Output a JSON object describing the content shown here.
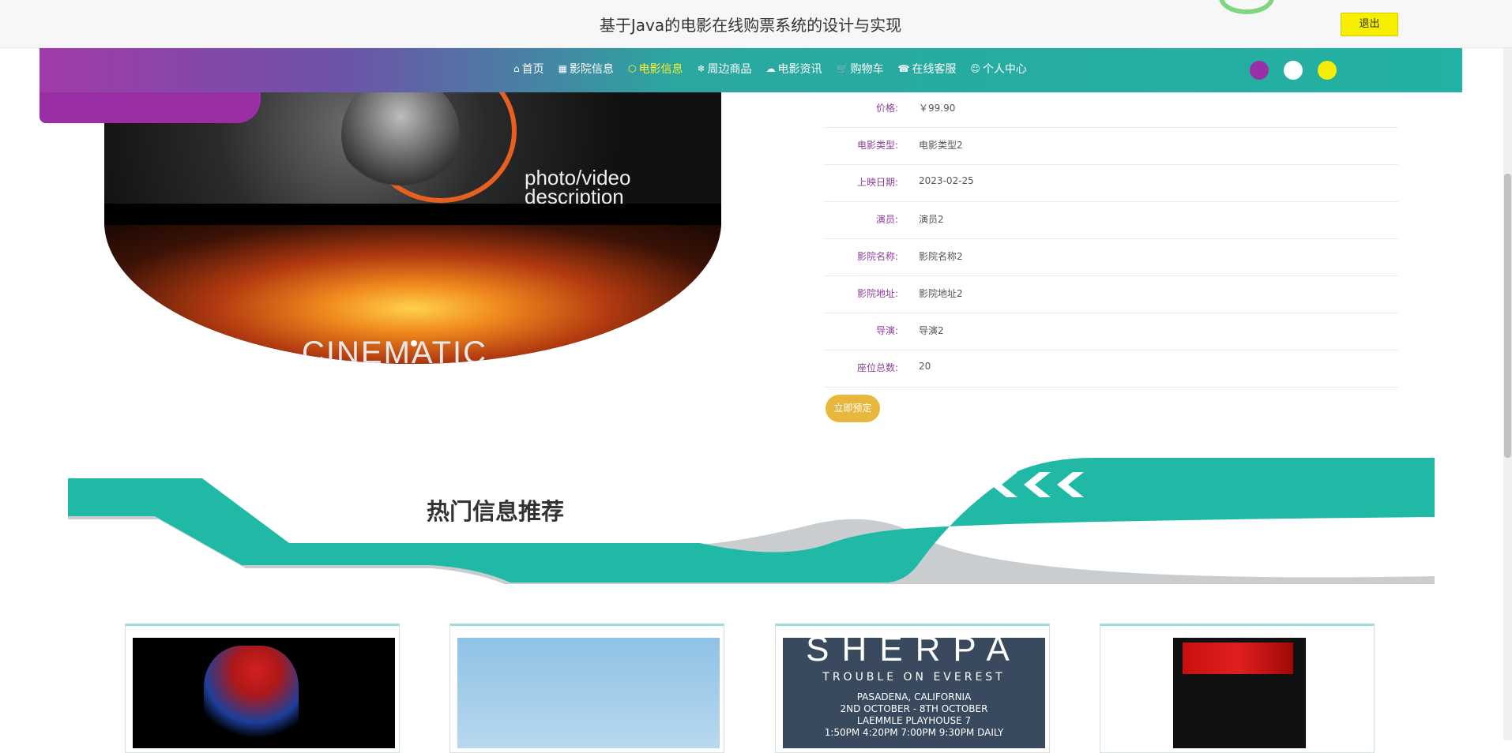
{
  "header": {
    "site_title": "基于Java的电影在线购票系统的设计与实现",
    "logout_label": "退出"
  },
  "nav": {
    "items": [
      {
        "icon": "home-icon",
        "glyph": "⌂",
        "label": "首页"
      },
      {
        "icon": "grid-icon",
        "glyph": "▦",
        "label": "影院信息"
      },
      {
        "icon": "box-icon",
        "glyph": "⬡",
        "label": "电影信息",
        "active": true
      },
      {
        "icon": "snowflake-icon",
        "glyph": "❄",
        "label": "周边商品"
      },
      {
        "icon": "chat-icon",
        "glyph": "☁",
        "label": "电影资讯"
      },
      {
        "icon": "cart-icon",
        "glyph": "🛒",
        "label": "购物车"
      },
      {
        "icon": "support-icon",
        "glyph": "☎",
        "label": "在线客服"
      },
      {
        "icon": "user-icon",
        "glyph": "☺",
        "label": "个人中心"
      }
    ],
    "theme_colors": [
      "#9b2fa8",
      "#ffffff",
      "#f4ee00"
    ]
  },
  "hero": {
    "caption_line1": "photo/video",
    "caption_line2": "description",
    "fire_word": "CINEMATIC"
  },
  "details": [
    {
      "label": "价格:",
      "value": "￥99.90"
    },
    {
      "label": "电影类型:",
      "value": "电影类型2"
    },
    {
      "label": "上映日期:",
      "value": "2023-02-25"
    },
    {
      "label": "演员:",
      "value": "演员2"
    },
    {
      "label": "影院名称:",
      "value": "影院名称2"
    },
    {
      "label": "影院地址:",
      "value": "影院地址2"
    },
    {
      "label": "导演:",
      "value": "导演2"
    },
    {
      "label": "座位总数:",
      "value": "20"
    }
  ],
  "book_button_label": "立即预定",
  "recommend": {
    "title": "热门信息推荐"
  },
  "cards": [
    {
      "name": "spider-poster"
    },
    {
      "name": "sky-poster"
    },
    {
      "name": "sherpa-poster",
      "title": "SHERPA",
      "subtitle": "TROUBLE ON EVEREST",
      "lines": [
        "PASADENA, CALIFORNIA",
        "2ND OCTOBER - 8TH OCTOBER",
        "LAEMMLE PLAYHOUSE 7",
        "1:50PM 4:20PM 7:00PM 9:30PM DAILY"
      ]
    },
    {
      "name": "chinese-poster"
    }
  ],
  "colors": {
    "teal": "#22b1a3",
    "purple": "#9b2fa8",
    "gold": "#e7b73e",
    "label_purple": "#8c3d9a"
  }
}
